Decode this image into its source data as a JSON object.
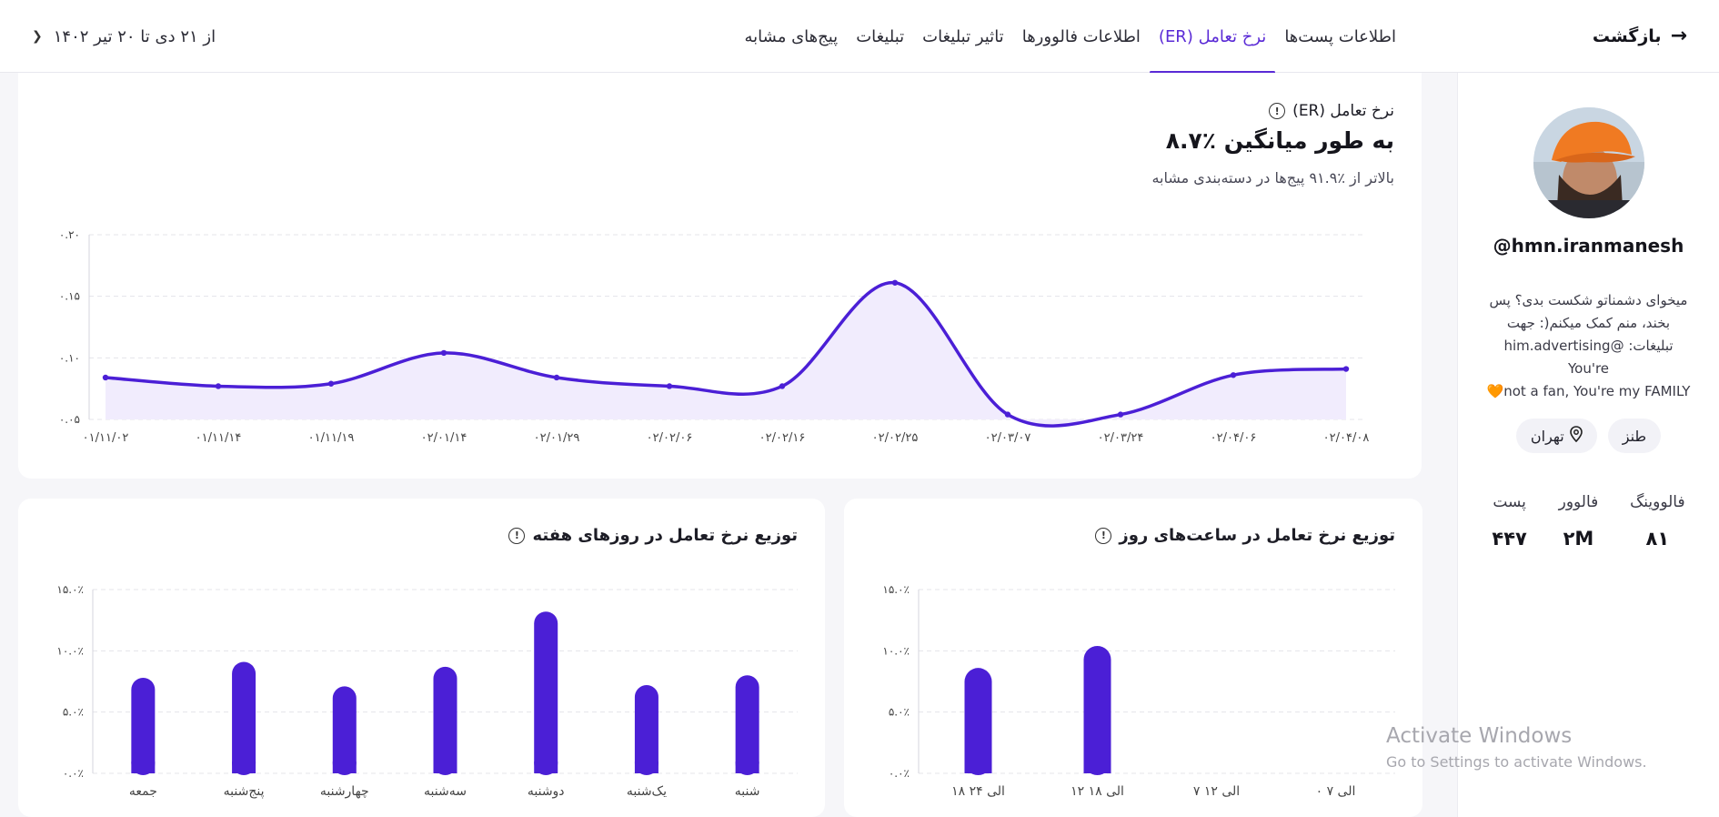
{
  "header": {
    "back_label": "بازگشت",
    "tabs": [
      {
        "label": "اطلاعات پست‌ها",
        "active": false
      },
      {
        "label": "نرخ تعامل (ER)",
        "active": true
      },
      {
        "label": "اطلاعات فالوورها",
        "active": false
      },
      {
        "label": "تاثیر تبلیغات",
        "active": false
      },
      {
        "label": "تبلیغات",
        "active": false
      },
      {
        "label": "پیج‌های مشابه",
        "active": false
      }
    ],
    "date_range": "از ۲۱ دی تا ۲۰ تیر ۱۴۰۲"
  },
  "profile": {
    "username": "@hmn.iranmanesh",
    "bio_lines": [
      "میخوای دشمناتو شکست بدی؟ پس",
      "بخند، منم کمک میکنم(: جهت",
      "تبلیغات: @him.advertising You're",
      "not a fan, You're my FAMILY"
    ],
    "bio_emoji": "🧡",
    "chips": [
      {
        "label": "طنز",
        "icon": ""
      },
      {
        "label": "تهران",
        "icon": "location-pin-icon"
      }
    ],
    "stats": [
      {
        "label": "فالووینگ",
        "value": "۸۱"
      },
      {
        "label": "فالوور",
        "value": "۲M"
      },
      {
        "label": "پست",
        "value": "۴۴۷"
      }
    ]
  },
  "er_card": {
    "title": "نرخ تعامل (ER)",
    "average": "به طور میانگین ٪۸.۷",
    "subtitle": "بالاتر از ٪۹۱.۹ پیج‌ها در دسته‌بندی مشابه"
  },
  "days_card": {
    "title": "توزیع نرخ تعامل در روزهای هفته"
  },
  "hours_card": {
    "title": "توزیع نرخ تعامل در ساعت‌های روز"
  },
  "watermark": {
    "line1": "Activate Windows",
    "line2": "Go to Settings to activate Windows."
  },
  "colors": {
    "accent": "#4b1fd6",
    "area_fill": "#f1ecfd",
    "grid": "#e4e4ea"
  },
  "chart_data": [
    {
      "type": "area",
      "x": [
        "۰۱/۱۱/۰۲",
        "۰۱/۱۱/۱۴",
        "۰۱/۱۱/۱۹",
        "۰۲/۰۱/۱۴",
        "۰۲/۰۱/۲۹",
        "۰۲/۰۲/۰۶",
        "۰۲/۰۲/۱۶",
        "۰۲/۰۲/۲۵",
        "۰۲/۰۳/۰۷",
        "۰۲/۰۳/۲۴",
        "۰۲/۰۴/۰۶",
        "۰۲/۰۴/۰۸"
      ],
      "values": [
        0.084,
        0.077,
        0.079,
        0.104,
        0.084,
        0.077,
        0.077,
        0.161,
        0.054,
        0.054,
        0.086,
        0.091
      ],
      "yticks": [
        "۰.۰۵",
        "۰.۱۰",
        "۰.۱۵",
        "۰.۲۰"
      ],
      "ylim": [
        0.05,
        0.2
      ],
      "grid": true
    },
    {
      "type": "bar",
      "categories": [
        "شنبه",
        "یک‌شنبه",
        "دوشنبه",
        "سه‌شنبه",
        "چهارشنبه",
        "پنج‌شنبه",
        "جمعه"
      ],
      "values": [
        8.0,
        7.2,
        13.2,
        8.7,
        7.1,
        9.1,
        7.8
      ],
      "yticks": [
        "۰.۰٪",
        "۵.۰٪",
        "۱۰.۰٪",
        "۱۵.۰٪"
      ],
      "ylim": [
        0,
        15
      ],
      "grid": true
    },
    {
      "type": "bar",
      "categories": [
        "۰ الی ۷",
        "۷ الی ۱۲",
        "۱۲ الی ۱۸",
        "۱۸ الی ۲۴"
      ],
      "values": [
        0,
        0,
        10.4,
        8.6
      ],
      "yticks": [
        "۰.۰٪",
        "۵.۰٪",
        "۱۰.۰٪",
        "۱۵.۰٪"
      ],
      "ylim": [
        0,
        15
      ],
      "grid": true
    }
  ]
}
